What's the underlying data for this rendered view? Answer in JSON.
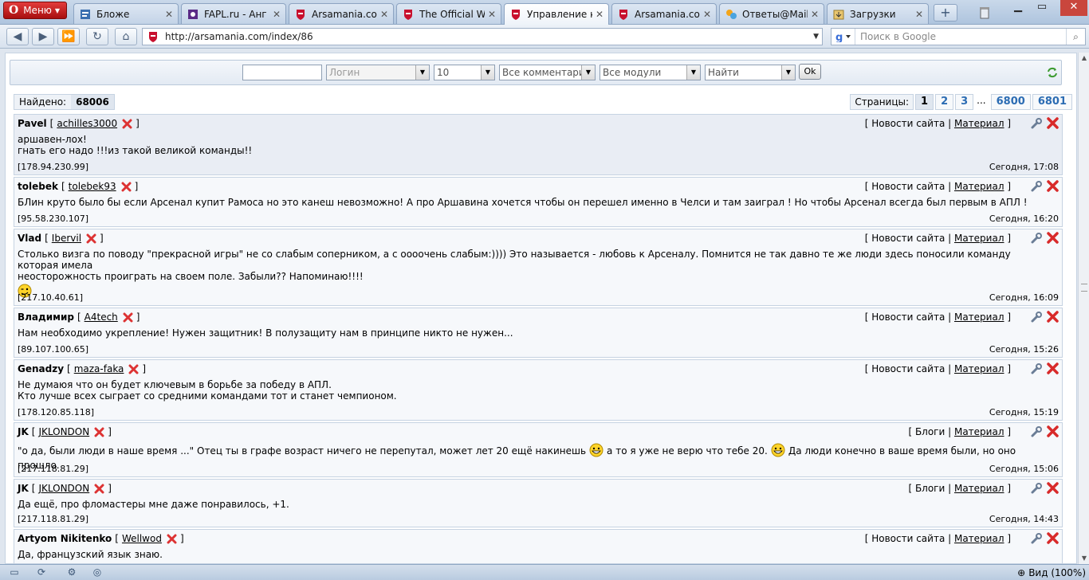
{
  "browser": {
    "menu_label": "Меню",
    "tabs": [
      {
        "label": "Бложе",
        "icon": "blog-icon"
      },
      {
        "label": "FAPL.ru - Анг",
        "icon": "fapl-icon"
      },
      {
        "label": "Arsamania.co",
        "icon": "arsenal-icon"
      },
      {
        "label": "The Official W",
        "icon": "arsenal-icon"
      },
      {
        "label": "Управление к",
        "icon": "arsenal-icon",
        "active": true
      },
      {
        "label": "Arsamania.co",
        "icon": "arsenal-icon"
      },
      {
        "label": "Ответы@Mail.",
        "icon": "mail-answers-icon"
      },
      {
        "label": "Загрузки",
        "icon": "downloads-icon"
      }
    ],
    "url": "http://arsamania.com/index/86",
    "search_placeholder": "Поиск в Google",
    "zoom_label": "Вид (100%)"
  },
  "filter": {
    "text_value": "",
    "login_placeholder": "Логин",
    "count_value": "10",
    "comments_value": "Все комментарии",
    "modules_value": "Все модули",
    "action_value": "Найти",
    "ok_label": "Ok"
  },
  "summary": {
    "found_label": "Найдено:",
    "found_count": "68006"
  },
  "pager": {
    "label": "Страницы:",
    "pages": [
      "1",
      "2",
      "3"
    ],
    "ellipsis": "...",
    "last_pages": [
      "6800",
      "6801"
    ]
  },
  "comments": [
    {
      "author": "Pavel",
      "login": "achilles3000",
      "module": "Новости сайта",
      "material": "Материал",
      "lines": [
        "аршавен-лох!",
        "гнать его надо !!!из такой великой команды!!"
      ],
      "ip": "[178.94.230.99]",
      "time": "Сегодня, 17:08"
    },
    {
      "author": "tolebek",
      "login": "tolebek93",
      "module": "Новости сайта",
      "material": "Материал",
      "lines": [
        "БЛин круто было бы если Арсенал купит Рамоса но это канеш невозможно! А про Аршавина хочется чтобы он перешел именно в Челси и там заиграл ! Но чтобы Арсенал всегда был первым в АПЛ !"
      ],
      "ip": "[95.58.230.107]",
      "time": "Сегодня, 16:20"
    },
    {
      "author": "Vlad",
      "login": "Ibervil",
      "module": "Новости сайта",
      "material": "Материал",
      "lines": [
        "Столько визга по поводу \"прекрасной игры\" не со слабым соперником, а с оооочень слабым:)))) Это называется - любовь к Арсеналу. Помнится не так давно те же люди здесь поносили команду которая имела",
        "неосторожность проиграть на своем поле. Забыли?? Напоминаю!!!!"
      ],
      "ip": "[217.10.40.61]",
      "time": "Сегодня, 16:09"
    },
    {
      "author": "Владимир",
      "login": "A4tech",
      "module": "Новости сайта",
      "material": "Материал",
      "lines": [
        "Нам необходимо укрепление! Нужен защитник! В полузащиту нам в принципе никто не нужен..."
      ],
      "ip": "[89.107.100.65]",
      "time": "Сегодня, 15:26"
    },
    {
      "author": "Genadzy",
      "login": "maza-faka",
      "module": "Новости сайта",
      "material": "Материал",
      "lines": [
        "Не думаюя что он будет ключевым в борьбе за победу в АПЛ.",
        "Кто лучше всех сыграет со средними командами тот и станет чемпионом."
      ],
      "ip": "[178.120.85.118]",
      "time": "Сегодня, 15:19"
    },
    {
      "author": "JK",
      "login": "JKLONDON",
      "module": "Блоги",
      "material": "Материал",
      "parts": [
        "\"о да, были люди в наше время ...\" Отец ты в графе возраст ничего не перепутал, может лет 20 ещё накинешь",
        "а то я уже не верю что тебе 20.",
        "Да люди конечно в ваше время были, но оно прошло."
      ],
      "ip": "[217.118.81.29]",
      "time": "Сегодня, 15:06"
    },
    {
      "author": "JK",
      "login": "JKLONDON",
      "module": "Блоги",
      "material": "Материал",
      "lines": [
        "Да ещё, про фломастеры мне даже понравилось, +1."
      ],
      "ip": "[217.118.81.29]",
      "time": "Сегодня, 14:43"
    },
    {
      "author": "Artyom Nikitenko",
      "login": "Wellwod",
      "module": "Новости сайта",
      "material": "Материал",
      "lines": [
        "Да, французский язык знаю."
      ],
      "ip": "",
      "time": ""
    }
  ]
}
